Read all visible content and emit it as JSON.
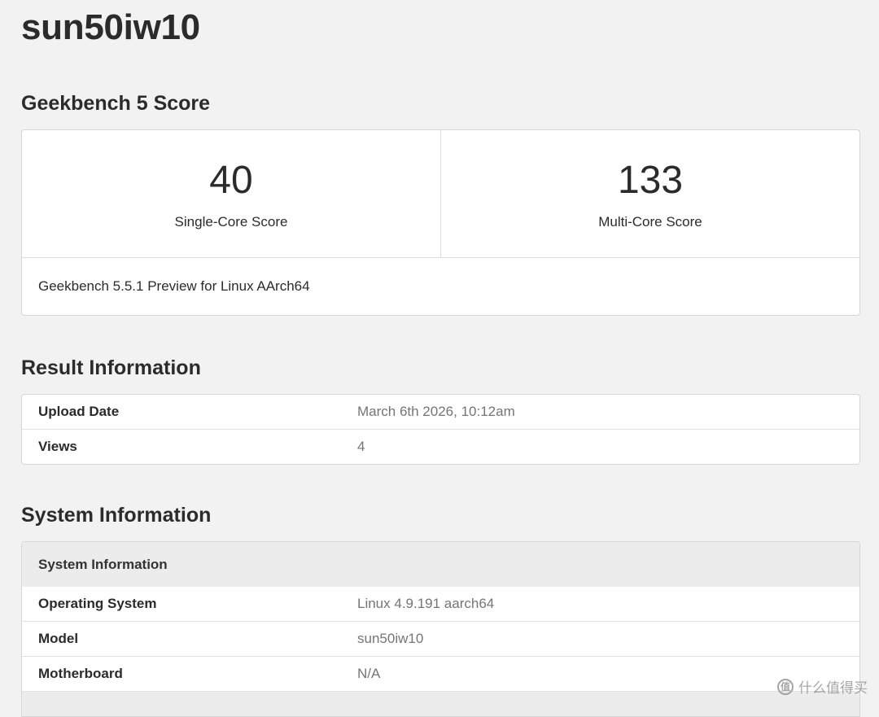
{
  "page": {
    "title": "sun50iw10"
  },
  "geekbench": {
    "section_title": "Geekbench 5 Score",
    "single_core": {
      "value": "40",
      "label": "Single-Core Score"
    },
    "multi_core": {
      "value": "133",
      "label": "Multi-Core Score"
    },
    "version": "Geekbench 5.5.1 Preview for Linux AArch64"
  },
  "result_info": {
    "section_title": "Result Information",
    "rows": [
      {
        "key": "Upload Date",
        "value": "March 6th 2026, 10:12am"
      },
      {
        "key": "Views",
        "value": "4"
      }
    ]
  },
  "system_info": {
    "section_title": "System Information",
    "subheader": "System Information",
    "rows": [
      {
        "key": "Operating System",
        "value": "Linux 4.9.191 aarch64"
      },
      {
        "key": "Model",
        "value": "sun50iw10"
      },
      {
        "key": "Motherboard",
        "value": "N/A"
      }
    ]
  },
  "watermark": {
    "icon_glyph": "值",
    "text": "什么值得买"
  }
}
